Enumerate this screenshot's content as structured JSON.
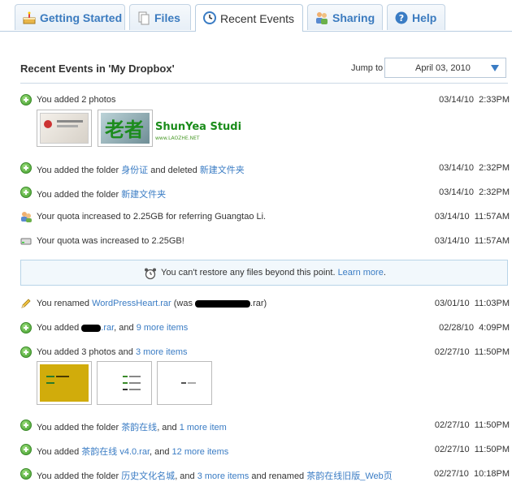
{
  "tabs": [
    {
      "label": "Getting Started",
      "icon": "cake-icon"
    },
    {
      "label": "Files",
      "icon": "files-icon"
    },
    {
      "label": "Recent Events",
      "icon": "clock-icon",
      "active": true
    },
    {
      "label": "Sharing",
      "icon": "people-icon"
    },
    {
      "label": "Help",
      "icon": "help-icon"
    }
  ],
  "header": {
    "title": "Recent Events in 'My Dropbox'",
    "jump_label": "Jump to",
    "jump_value": "April 03, 2010"
  },
  "watermark": {
    "title": "ShunYea Studio",
    "sub": "www.LAOZHE.NET",
    "logo": "老者"
  },
  "events": [
    {
      "pre": "You added 2 photos",
      "date": "03/14/10",
      "time": "2:33PM",
      "icon": "add-icon"
    },
    {
      "pre": "You added the folder ",
      "link1": "身份证",
      "mid": " and deleted ",
      "link2": "新建文件夹",
      "date": "03/14/10",
      "time": "2:32PM",
      "icon": "add-icon"
    },
    {
      "pre": "You added the folder ",
      "link1": "新建文件夹",
      "date": "03/14/10",
      "time": "2:32PM",
      "icon": "add-icon"
    },
    {
      "pre": "Your quota increased to 2.25GB for referring Guangtao Li.",
      "date": "03/14/10",
      "time": "11:57AM",
      "icon": "referral-icon"
    },
    {
      "pre": "Your quota was increased to 2.25GB!",
      "date": "03/14/10",
      "time": "11:57AM",
      "icon": "drive-icon"
    },
    {
      "pre": "You renamed ",
      "link1": "WordPressHeart.rar",
      "mid": " (was ",
      "post": ".rar)",
      "date": "03/01/10",
      "time": "11:03PM",
      "icon": "pencil-icon"
    },
    {
      "pre": "You added ",
      "link1": ".rar",
      "mid": ", and ",
      "link2": "9 more items",
      "date": "02/28/10",
      "time": "4:09PM",
      "icon": "add-icon"
    },
    {
      "pre": "You added 3 photos and ",
      "link1": "3 more items",
      "date": "02/27/10",
      "time": "11:50PM",
      "icon": "add-icon"
    },
    {
      "pre": "You added the folder ",
      "link1": "茶韵在线",
      "mid": ", and ",
      "link2": "1 more item",
      "date": "02/27/10",
      "time": "11:50PM",
      "icon": "add-icon"
    },
    {
      "pre": "You added ",
      "link1": "茶韵在线 v4.0.rar",
      "mid": ", and ",
      "link2": "12 more items",
      "date": "02/27/10",
      "time": "11:50PM",
      "icon": "add-icon"
    },
    {
      "pre": "You added the folder ",
      "link1": "历史文化名城",
      "mid": ", and ",
      "link2": "3 more items",
      "mid2": " and renamed ",
      "link3": "茶韵在线旧版_Web页",
      "date": "02/27/10",
      "time": "10:18PM",
      "icon": "add-icon"
    }
  ],
  "notice": {
    "text": "You can't restore any files beyond this point. ",
    "link": "Learn more",
    "post": "."
  },
  "colors": {
    "link": "#3a7cc4",
    "tab_text": "#3b7bbf",
    "notice_bg": "#f2f8fc"
  }
}
